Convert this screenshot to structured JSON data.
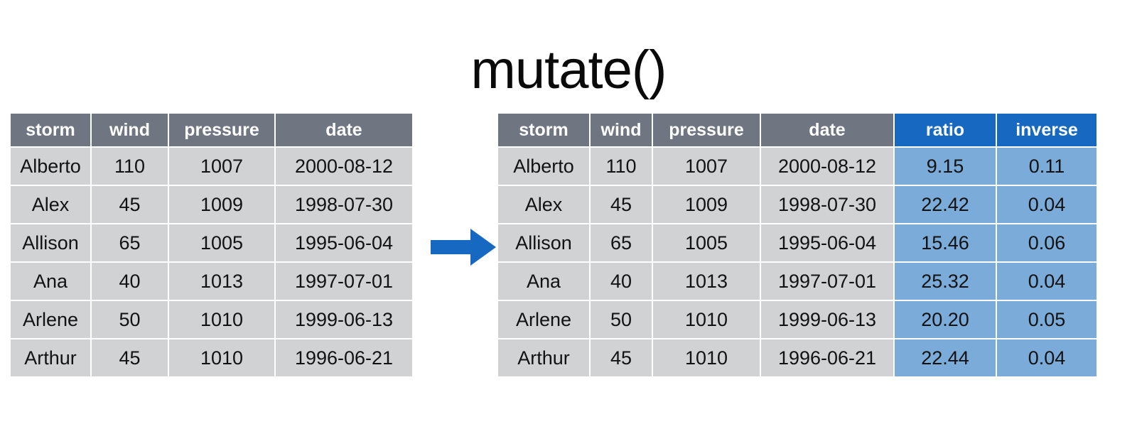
{
  "title": "mutate()",
  "colors": {
    "header_gray": "#6f7681",
    "cell_gray": "#d0d2d4",
    "accent_header_blue": "#1668c1",
    "accent_cell_blue": "#7aabd9",
    "arrow_blue": "#1668c1",
    "title_black": "#0a0a0a"
  },
  "arrow": {
    "icon": "arrow-right-icon",
    "direction": "right"
  },
  "tables": {
    "original": {
      "columns": [
        "storm",
        "wind",
        "pressure",
        "date"
      ],
      "rows": [
        [
          "Alberto",
          "110",
          "1007",
          "2000-08-12"
        ],
        [
          "Alex",
          "45",
          "1009",
          "1998-07-30"
        ],
        [
          "Allison",
          "65",
          "1005",
          "1995-06-04"
        ],
        [
          "Ana",
          "40",
          "1013",
          "1997-07-01"
        ],
        [
          "Arlene",
          "50",
          "1010",
          "1999-06-13"
        ],
        [
          "Arthur",
          "45",
          "1010",
          "1996-06-21"
        ]
      ]
    },
    "mutated": {
      "columns": [
        "storm",
        "wind",
        "pressure",
        "date",
        "ratio",
        "inverse"
      ],
      "accent_columns": [
        "ratio",
        "inverse"
      ],
      "rows": [
        [
          "Alberto",
          "110",
          "1007",
          "2000-08-12",
          "9.15",
          "0.11"
        ],
        [
          "Alex",
          "45",
          "1009",
          "1998-07-30",
          "22.42",
          "0.04"
        ],
        [
          "Allison",
          "65",
          "1005",
          "1995-06-04",
          "15.46",
          "0.06"
        ],
        [
          "Ana",
          "40",
          "1013",
          "1997-07-01",
          "25.32",
          "0.04"
        ],
        [
          "Arlene",
          "50",
          "1010",
          "1999-06-13",
          "20.20",
          "0.05"
        ],
        [
          "Arthur",
          "45",
          "1010",
          "1996-06-21",
          "22.44",
          "0.04"
        ]
      ]
    }
  }
}
